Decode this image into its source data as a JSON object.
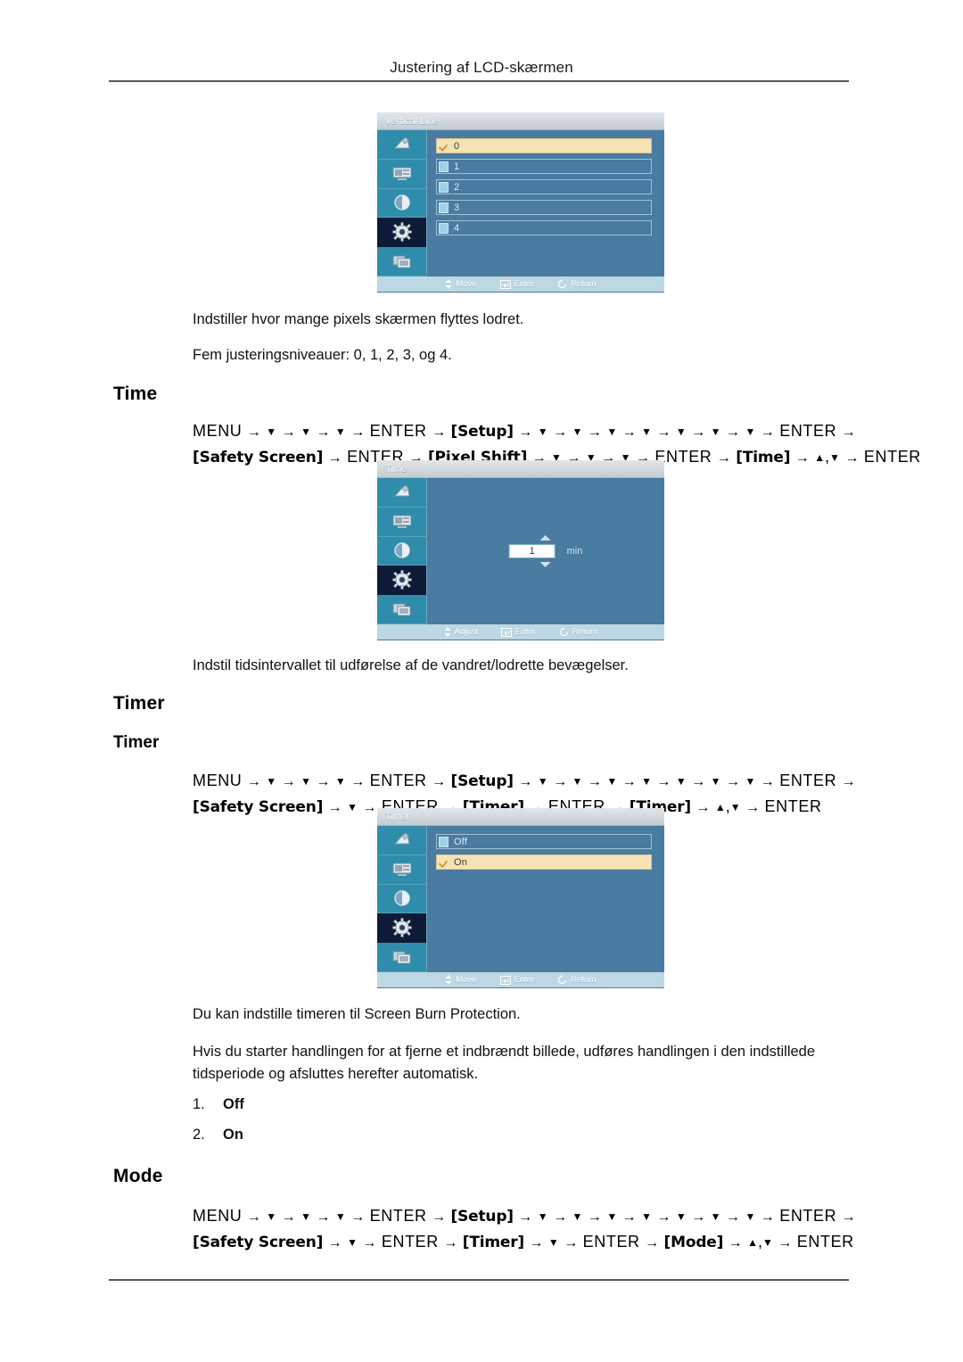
{
  "document": {
    "header_title": "Justering af LCD-skærmen"
  },
  "sections": [
    {
      "id": "vertical_line",
      "osd": {
        "title": "Vertical Line",
        "type": "list",
        "options": [
          {
            "label": "0",
            "selected": true
          },
          {
            "label": "1",
            "selected": false
          },
          {
            "label": "2",
            "selected": false
          },
          {
            "label": "3",
            "selected": false
          },
          {
            "label": "4",
            "selected": false
          }
        ],
        "hints": [
          "Move",
          "Enter",
          "Return"
        ]
      },
      "paragraphs": [
        "Indstiller hvor mange pixels skærmen flyttes lodret.",
        "Fem justeringsniveauer: 0, 1, 2, 3, og 4."
      ]
    },
    {
      "id": "time",
      "heading": "Time",
      "path_line1": [
        {
          "t": "key",
          "v": "MENU"
        },
        {
          "t": "arrow"
        },
        {
          "t": "tri",
          "v": "▼"
        },
        {
          "t": "arrow"
        },
        {
          "t": "tri",
          "v": "▼"
        },
        {
          "t": "arrow"
        },
        {
          "t": "tri",
          "v": "▼"
        },
        {
          "t": "arrow"
        },
        {
          "t": "key",
          "v": "ENTER"
        },
        {
          "t": "arrow"
        },
        {
          "t": "tag",
          "v": "[Setup]"
        },
        {
          "t": "arrow"
        },
        {
          "t": "tri",
          "v": "▼"
        },
        {
          "t": "arrow"
        },
        {
          "t": "tri",
          "v": "▼"
        },
        {
          "t": "arrow"
        },
        {
          "t": "tri",
          "v": "▼"
        },
        {
          "t": "arrow"
        },
        {
          "t": "tri",
          "v": "▼"
        },
        {
          "t": "arrow"
        },
        {
          "t": "tri",
          "v": "▼"
        },
        {
          "t": "arrow"
        },
        {
          "t": "tri",
          "v": "▼"
        },
        {
          "t": "arrow"
        },
        {
          "t": "tri",
          "v": "▼"
        },
        {
          "t": "arrow"
        },
        {
          "t": "key",
          "v": "ENTER"
        },
        {
          "t": "arrow"
        }
      ],
      "path_line2": [
        {
          "t": "tag",
          "v": "[Safety Screen]"
        },
        {
          "t": "arrow"
        },
        {
          "t": "key",
          "v": "ENTER"
        },
        {
          "t": "arrow"
        },
        {
          "t": "tag",
          "v": "[Pixel Shift]"
        },
        {
          "t": "arrow"
        },
        {
          "t": "tri",
          "v": "▼"
        },
        {
          "t": "arrow"
        },
        {
          "t": "tri",
          "v": "▼"
        },
        {
          "t": "arrow"
        },
        {
          "t": "tri",
          "v": "▼"
        },
        {
          "t": "arrow"
        },
        {
          "t": "key",
          "v": "ENTER"
        },
        {
          "t": "arrow"
        },
        {
          "t": "tag",
          "v": "[Time]"
        },
        {
          "t": "arrow"
        },
        {
          "t": "tri",
          "v": "▲"
        },
        {
          "t": "plain",
          "v": ","
        },
        {
          "t": "tri",
          "v": "▼"
        },
        {
          "t": "arrow"
        },
        {
          "t": "key",
          "v": "ENTER"
        }
      ],
      "osd": {
        "title": "Time",
        "type": "spinner",
        "value": "1",
        "unit": "min",
        "hints": [
          "Adjust",
          "Enter",
          "Return"
        ]
      },
      "paragraphs": [
        "Indstil tidsintervallet til udførelse af de vandret/lodrette bevægelser."
      ]
    },
    {
      "id": "timer",
      "heading": "Timer",
      "subheading": "Timer",
      "path_line1": [
        {
          "t": "key",
          "v": "MENU"
        },
        {
          "t": "arrow"
        },
        {
          "t": "tri",
          "v": "▼"
        },
        {
          "t": "arrow"
        },
        {
          "t": "tri",
          "v": "▼"
        },
        {
          "t": "arrow"
        },
        {
          "t": "tri",
          "v": "▼"
        },
        {
          "t": "arrow"
        },
        {
          "t": "key",
          "v": "ENTER"
        },
        {
          "t": "arrow"
        },
        {
          "t": "tag",
          "v": "[Setup]"
        },
        {
          "t": "arrow"
        },
        {
          "t": "tri",
          "v": "▼"
        },
        {
          "t": "arrow"
        },
        {
          "t": "tri",
          "v": "▼"
        },
        {
          "t": "arrow"
        },
        {
          "t": "tri",
          "v": "▼"
        },
        {
          "t": "arrow"
        },
        {
          "t": "tri",
          "v": "▼"
        },
        {
          "t": "arrow"
        },
        {
          "t": "tri",
          "v": "▼"
        },
        {
          "t": "arrow"
        },
        {
          "t": "tri",
          "v": "▼"
        },
        {
          "t": "arrow"
        },
        {
          "t": "tri",
          "v": "▼"
        },
        {
          "t": "arrow"
        },
        {
          "t": "key",
          "v": "ENTER"
        },
        {
          "t": "arrow"
        }
      ],
      "path_line2": [
        {
          "t": "tag",
          "v": "[Safety Screen]"
        },
        {
          "t": "arrow"
        },
        {
          "t": "tri",
          "v": "▼"
        },
        {
          "t": "arrow"
        },
        {
          "t": "key",
          "v": "ENTER"
        },
        {
          "t": "arrow"
        },
        {
          "t": "tag",
          "v": "[Timer]"
        },
        {
          "t": "arrow"
        },
        {
          "t": "key",
          "v": "ENTER"
        },
        {
          "t": "arrow"
        },
        {
          "t": "tag",
          "v": "[Timer]"
        },
        {
          "t": "arrow"
        },
        {
          "t": "tri",
          "v": "▲"
        },
        {
          "t": "plain",
          "v": ","
        },
        {
          "t": "tri",
          "v": "▼"
        },
        {
          "t": "arrow"
        },
        {
          "t": "key",
          "v": "ENTER"
        }
      ],
      "osd": {
        "title": "Timer",
        "type": "list",
        "options": [
          {
            "label": "Off",
            "selected": false
          },
          {
            "label": "On",
            "selected": true
          }
        ],
        "hints": [
          "Move",
          "Enter",
          "Return"
        ]
      },
      "paragraphs": [
        "Du kan indstille timeren til Screen Burn Protection.",
        "Hvis du starter handlingen for at fjerne et indbrændt billede, udføres handlingen i den indstillede tidsperiode og afsluttes herefter automatisk."
      ],
      "list": [
        {
          "num": "1.",
          "text": "Off"
        },
        {
          "num": "2.",
          "text": "On"
        }
      ]
    },
    {
      "id": "mode",
      "heading": "Mode",
      "path_line1": [
        {
          "t": "key",
          "v": "MENU"
        },
        {
          "t": "arrow"
        },
        {
          "t": "tri",
          "v": "▼"
        },
        {
          "t": "arrow"
        },
        {
          "t": "tri",
          "v": "▼"
        },
        {
          "t": "arrow"
        },
        {
          "t": "tri",
          "v": "▼"
        },
        {
          "t": "arrow"
        },
        {
          "t": "key",
          "v": "ENTER"
        },
        {
          "t": "arrow"
        },
        {
          "t": "tag",
          "v": "[Setup]"
        },
        {
          "t": "arrow"
        },
        {
          "t": "tri",
          "v": "▼"
        },
        {
          "t": "arrow"
        },
        {
          "t": "tri",
          "v": "▼"
        },
        {
          "t": "arrow"
        },
        {
          "t": "tri",
          "v": "▼"
        },
        {
          "t": "arrow"
        },
        {
          "t": "tri",
          "v": "▼"
        },
        {
          "t": "arrow"
        },
        {
          "t": "tri",
          "v": "▼"
        },
        {
          "t": "arrow"
        },
        {
          "t": "tri",
          "v": "▼"
        },
        {
          "t": "arrow"
        },
        {
          "t": "tri",
          "v": "▼"
        },
        {
          "t": "arrow"
        },
        {
          "t": "key",
          "v": "ENTER"
        },
        {
          "t": "arrow"
        }
      ],
      "path_line2": [
        {
          "t": "tag",
          "v": "[Safety Screen]"
        },
        {
          "t": "arrow"
        },
        {
          "t": "tri",
          "v": "▼"
        },
        {
          "t": "arrow"
        },
        {
          "t": "key",
          "v": "ENTER"
        },
        {
          "t": "arrow"
        },
        {
          "t": "tag",
          "v": "[Timer]"
        },
        {
          "t": "arrow"
        },
        {
          "t": "tri",
          "v": "▼"
        },
        {
          "t": "arrow"
        },
        {
          "t": "key",
          "v": "ENTER"
        },
        {
          "t": "arrow"
        },
        {
          "t": "tag",
          "v": "[Mode]"
        },
        {
          "t": "arrow"
        },
        {
          "t": "tri",
          "v": "▲"
        },
        {
          "t": "plain",
          "v": ","
        },
        {
          "t": "tri",
          "v": "▼"
        },
        {
          "t": "arrow"
        },
        {
          "t": "key",
          "v": "ENTER"
        }
      ]
    }
  ],
  "osd_sidebar_icons": [
    "picture-icon",
    "display-icon",
    "sound-icon",
    "setup-gear-icon",
    "multi-control-icon"
  ],
  "colors": {
    "osd_background": "#4a7ba0",
    "osd_sidebar": "#2f8cab",
    "osd_selected_icon": "#0d1b38",
    "osd_highlight": "#f6e2b4",
    "osd_footer": "#bdd7e3"
  }
}
